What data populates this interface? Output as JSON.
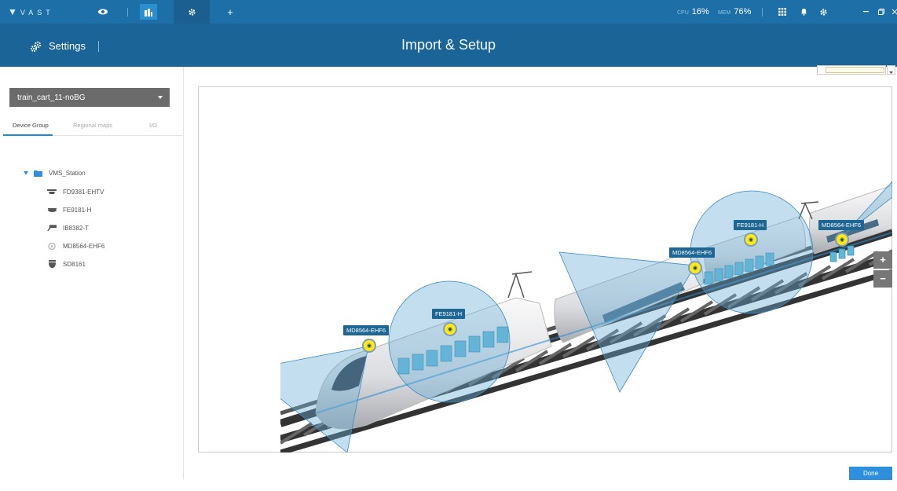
{
  "app": {
    "logo_text": "VAST",
    "cpu_label": "CPU",
    "cpu_value": "16%",
    "mem_label": "MEM",
    "mem_value": "76%"
  },
  "header": {
    "settings_label": "Settings",
    "title": "Import & Setup"
  },
  "left_panel": {
    "map_select_value": "train_cart_11-noBG",
    "tabs": [
      "Device Group",
      "Regional maps",
      "I/O"
    ],
    "tree": {
      "root": "VMS_Station",
      "devices": [
        "FD9381-EHTV",
        "FE9181-H",
        "IB8382-T",
        "MD8564-EHF6",
        "SD8161"
      ]
    }
  },
  "map": {
    "camera_labels": [
      "MD8564-EHF6",
      "FE9181-H",
      "MD8564-EHF6",
      "FE9181-H",
      "MD8564-EHF6"
    ]
  },
  "footer": {
    "done_label": "Done"
  },
  "colors": {
    "topbar": "#1d6fa8",
    "header": "#1a6497",
    "accent": "#2e8fdc",
    "fov": "#6aaed6"
  }
}
